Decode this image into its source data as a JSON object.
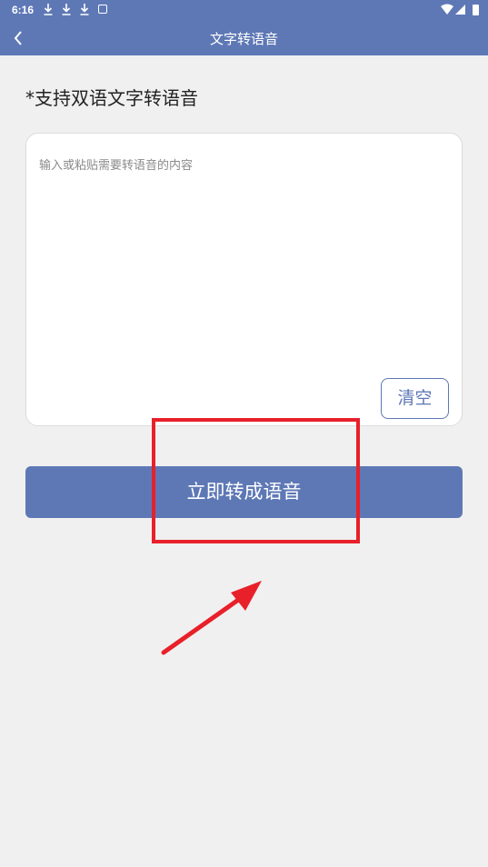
{
  "status_bar": {
    "time": "6:16",
    "icons": [
      "download-icon",
      "download-icon",
      "download-icon",
      "app-notification-icon",
      "wifi-icon",
      "signal-icon",
      "battery-icon"
    ]
  },
  "app_bar": {
    "title": "文字转语音",
    "back_icon": "chevron-left-icon"
  },
  "heading": "*支持双语文字转语音",
  "editor": {
    "value": "",
    "placeholder": "输入或粘贴需要转语音的内容",
    "clear_label": "清空"
  },
  "convert_button_label": "立即转成语音",
  "annotation": {
    "highlight_color": "#e8202a",
    "arrow_icon": "red-arrow-icon"
  },
  "colors": {
    "brand": "#5e78b6",
    "background": "#f0f0f0"
  }
}
